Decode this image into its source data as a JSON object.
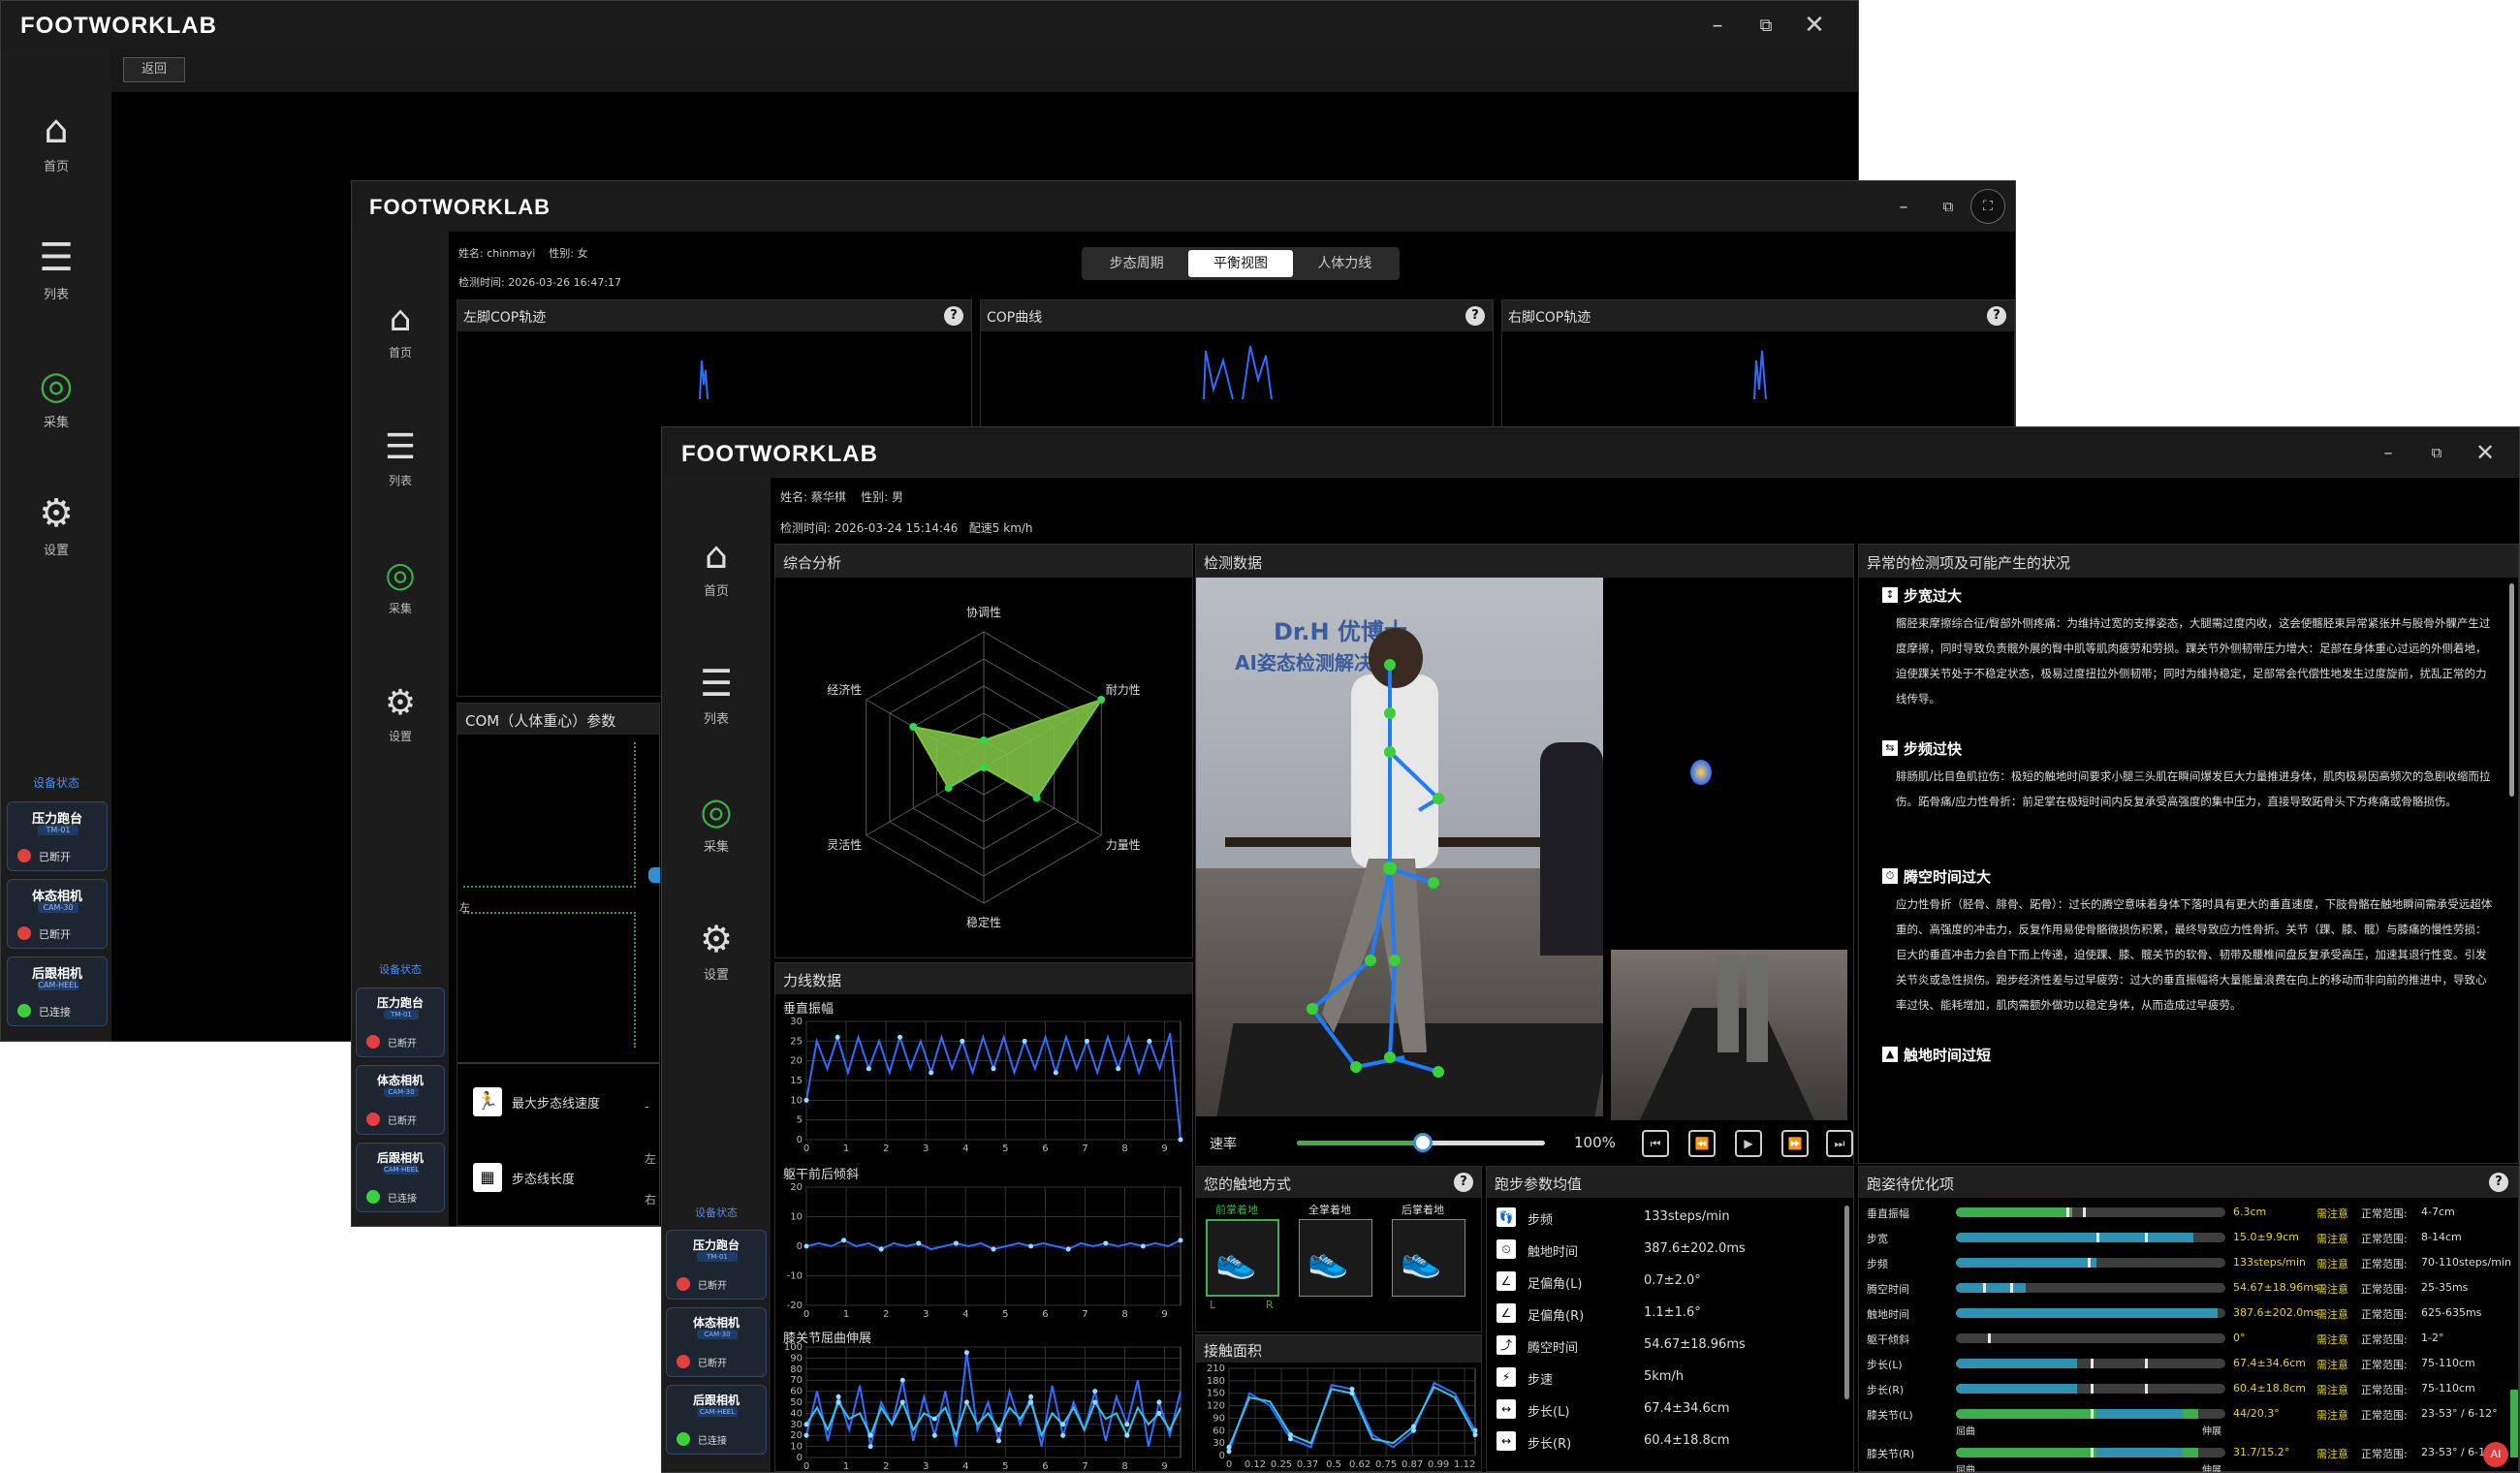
{
  "brand": "FOOTWORKLAB",
  "win1": {
    "back_label": "返回",
    "nav": [
      "首页",
      "列表",
      "采集",
      "设置"
    ],
    "device_header": "设备状态",
    "devices": [
      {
        "name": "压力跑台",
        "code": "TM-01",
        "status": "已断开",
        "state": "red"
      },
      {
        "name": "体态相机",
        "code": "CAM-30",
        "status": "已断开",
        "state": "red"
      },
      {
        "name": "后跟相机",
        "code": "CAM-HEEL",
        "status": "已连接",
        "state": "green"
      }
    ]
  },
  "win2": {
    "name_label": "姓名:",
    "name": "chinmayi",
    "gender_label": "性别:",
    "gender": "女",
    "time_label": "检测时间:",
    "time": "2026-03-26 16:47:17",
    "tabs": [
      "步态周期",
      "平衡视图",
      "人体力线"
    ],
    "active_tab": 1,
    "panels": [
      "左脚COP轨迹",
      "COP曲线",
      "右脚COP轨迹"
    ],
    "com_title": "COM（人体重心）参数",
    "com_left_label": "左",
    "params": [
      "最大步态线速度",
      "步态线长度"
    ],
    "param_side": [
      "左",
      "右"
    ],
    "param_dash": "-",
    "nav": [
      "首页",
      "列表",
      "采集",
      "设置"
    ],
    "device_header": "设备状态",
    "devices": [
      {
        "name": "压力跑台",
        "code": "TM-01",
        "status": "已断开",
        "state": "red"
      },
      {
        "name": "体态相机",
        "code": "CAM-30",
        "status": "已断开",
        "state": "red"
      },
      {
        "name": "后跟相机",
        "code": "CAM-HEEL",
        "status": "已连接",
        "state": "green"
      }
    ]
  },
  "win3": {
    "name_label": "姓名:",
    "name": "蔡华棋",
    "gender_label": "性别:",
    "gender": "男",
    "time_label": "检测时间:",
    "time": "2026-03-24 15:14:46",
    "speed_label": "配速",
    "speed": "5 km/h",
    "nav": [
      "首页",
      "列表",
      "采集",
      "设置"
    ],
    "device_header": "设备状态",
    "devices": [
      {
        "name": "压力跑台",
        "code": "TM-01",
        "status": "已断开",
        "state": "red"
      },
      {
        "name": "体态相机",
        "code": "CAM-30",
        "status": "已断开",
        "state": "red"
      },
      {
        "name": "后跟相机",
        "code": "CAM-HEEL",
        "status": "已连接",
        "state": "green"
      }
    ],
    "overall_title": "综合分析",
    "radar_axes": [
      "协调性",
      "耐力性",
      "力量性",
      "稳定性",
      "灵活性",
      "经济性"
    ],
    "force_title": "力线数据",
    "vert_osc_title": "垂直振幅",
    "trunk_title": "躯干前后倾斜",
    "knee_title": "膝关节屈曲伸展",
    "detect_title": "检测数据",
    "wall_text": [
      "Dr.H 优博士",
      "AI姿态检测解决方案"
    ],
    "speed_rate_label": "速率",
    "playback": "100%",
    "strike_title": "您的触地方式",
    "strike_types": [
      "前掌着地",
      "全掌着地",
      "后掌着地"
    ],
    "strike_lr": [
      "L",
      "R"
    ],
    "contact_title": "接触面积",
    "params_title": "跑步参数均值",
    "params": [
      {
        "label": "步频",
        "value": "133steps/min"
      },
      {
        "label": "触地时间",
        "value": "387.6±202.0ms"
      },
      {
        "label": "足偏角(L)",
        "value": "0.7±2.0°"
      },
      {
        "label": "足偏角(R)",
        "value": "1.1±1.6°"
      },
      {
        "label": "腾空时间",
        "value": "54.67±18.96ms"
      },
      {
        "label": "步速",
        "value": "5km/h"
      },
      {
        "label": "步长(L)",
        "value": "67.4±34.6cm"
      },
      {
        "label": "步长(R)",
        "value": "60.4±18.8cm"
      }
    ],
    "abnormal_title": "异常的检测项及可能产生的状况",
    "abnormal": [
      {
        "icon": "↕",
        "title": "步宽过大",
        "text": "髂胫束摩擦综合征/臀部外侧疼痛：为维持过宽的支撑姿态，大腿需过度内收，这会使髂胫束异常紧张并与股骨外髁产生过度摩擦，同时导致负责髋外展的臀中肌等肌肉疲劳和劳损。踝关节外侧韧带压力增大：足部在身体重心过远的外侧着地，迫使踝关节处于不稳定状态，极易过度扭拉外侧韧带；同时为维持稳定，足部常会代偿性地发生过度旋前，扰乱正常的力线传导。"
      },
      {
        "icon": "⇆",
        "title": "步频过快",
        "text": "腓肠肌/比目鱼肌拉伤：极短的触地时间要求小腿三头肌在瞬间爆发巨大力量推进身体，肌肉极易因高频次的急剧收缩而拉伤。跖骨痛/应力性骨折：前足掌在极短时间内反复承受高强度的集中压力，直接导致跖骨头下方疼痛或骨骼损伤。"
      },
      {
        "icon": "⏱",
        "title": "腾空时间过大",
        "text": "应力性骨折（胫骨、腓骨、跖骨）：过长的腾空意味着身体下落时具有更大的垂直速度，下肢骨骼在触地瞬间需承受远超体重的、高强度的冲击力，反复作用易使骨骼微损伤积累，最终导致应力性骨折。关节（踝、膝、髋）与膝痛的慢性劳损：巨大的垂直冲击力会自下而上传递，迫使踝、膝、髋关节的软骨、韧带及腰椎间盘反复承受高压，加速其退行性变。引发关节炎或急性损伤。跑步经济性差与过早疲劳：过大的垂直振幅将大量能量浪费在向上的移动而非向前的推进中，导致心率过快、能耗增加，肌肉需额外做功以稳定身体，从而造成过早疲劳。"
      },
      {
        "icon": "▲",
        "title": "触地时间过短",
        "text": ""
      }
    ],
    "opt_title": "跑姿待优化项",
    "opt_items": [
      {
        "label": "垂直振幅",
        "value": "6.3cm",
        "flag": "需注意",
        "range_label": "正常范围:",
        "range": "4-7cm",
        "fill": 0.43,
        "color": "#3daf4a",
        "ticks": [
          0.41,
          0.47
        ]
      },
      {
        "label": "步宽",
        "value": "15.0±9.9cm",
        "flag": "需注意",
        "range_label": "正常范围:",
        "range": "8-14cm",
        "fill": 0.88,
        "color": "#2e93b3",
        "ticks": [
          0.52,
          0.7
        ]
      },
      {
        "label": "步频",
        "value": "133steps/min",
        "flag": "需注意",
        "range_label": "正常范围:",
        "range": "70-110steps/min",
        "fill": 0.52,
        "color": "#2e93b3",
        "ticks": [
          0.49
        ]
      },
      {
        "label": "腾空时间",
        "value": "54.67±18.96ms",
        "flag": "需注意",
        "range_label": "正常范围:",
        "range": "25-35ms",
        "fill": 0.26,
        "color": "#2e93b3",
        "ticks": [
          0.1,
          0.2
        ]
      },
      {
        "label": "触地时间",
        "value": "387.6±202.0ms",
        "flag": "需注意",
        "range_label": "正常范围:",
        "range": "625-635ms",
        "fill": 0.97,
        "color": "#2e93b3",
        "ticks": []
      },
      {
        "label": "躯干倾斜",
        "value": "0°",
        "flag": "需注意",
        "range_label": "正常范围:",
        "range": "1-2°",
        "fill": 0.0,
        "color": "#2e93b3",
        "ticks": [
          0.12
        ]
      },
      {
        "label": "步长(L)",
        "value": "67.4±34.6cm",
        "flag": "需注意",
        "range_label": "正常范围:",
        "range": "75-110cm",
        "fill": 0.45,
        "color": "#2e93b3",
        "ticks": [
          0.5,
          0.7
        ]
      },
      {
        "label": "步长(R)",
        "value": "60.4±18.8cm",
        "flag": "需注意",
        "range_label": "正常范围:",
        "range": "75-110cm",
        "fill": 0.45,
        "color": "#2e93b3",
        "ticks": [
          0.5,
          0.7
        ]
      },
      {
        "label": "膝关节(L)",
        "value": "44/20.3°",
        "flag": "需注意",
        "range_label": "正常范围:",
        "range": "23-53° / 6-12°",
        "fill": 0.9,
        "color": "#3daf4a",
        "ticks": [
          0.5
        ],
        "sub": [
          "屈曲",
          "伸展"
        ]
      },
      {
        "label": "膝关节(R)",
        "value": "31.7/15.2°",
        "flag": "需注意",
        "range_label": "正常范围:",
        "range": "23-53° / 6-12°",
        "fill": 0.9,
        "color": "#3daf4a",
        "ticks": [
          0.5
        ],
        "sub": [
          "屈曲",
          "伸展"
        ]
      }
    ]
  },
  "chart_data": [
    {
      "type": "radar",
      "title": "综合分析",
      "axes": [
        "协调性",
        "耐力性",
        "力量性",
        "稳定性",
        "灵活性",
        "经济性"
      ],
      "values": [
        0.2,
        1.0,
        0.45,
        0.0,
        0.3,
        0.6
      ],
      "color": "#7ec242"
    },
    {
      "type": "line",
      "title": "垂直振幅",
      "x_ticks": [
        "0",
        "1",
        "2",
        "3",
        "4",
        "5",
        "6",
        "7",
        "8",
        "9"
      ],
      "y_ticks": [
        "0",
        "5",
        "10",
        "15",
        "20",
        "25",
        "30"
      ],
      "ylim": [
        0,
        30
      ],
      "series": [
        {
          "values": [
            10,
            25,
            18,
            26,
            17,
            26,
            18,
            25,
            17,
            26,
            18,
            25,
            17,
            26,
            18,
            25,
            17,
            26,
            18,
            26,
            17,
            25,
            18,
            26,
            17,
            26,
            18,
            25,
            17,
            26,
            18,
            26,
            17,
            25,
            18,
            27,
            0
          ]
        }
      ]
    },
    {
      "type": "line",
      "title": "躯干前后倾斜",
      "x_ticks": [
        "0",
        "1",
        "2",
        "3",
        "4",
        "5",
        "6",
        "7",
        "8",
        "9"
      ],
      "y_ticks": [
        "-20",
        "-10",
        "0",
        "10",
        "20"
      ],
      "ylim": [
        -20,
        20
      ],
      "series": [
        {
          "values": [
            0,
            1,
            0,
            2,
            0,
            1,
            -1,
            1,
            0,
            1,
            -1,
            0,
            1,
            0,
            1,
            -1,
            0,
            1,
            0,
            1,
            0,
            -1,
            1,
            0,
            1,
            0,
            1,
            0,
            1,
            0,
            2
          ]
        }
      ]
    },
    {
      "type": "line",
      "title": "膝关节屈曲伸展",
      "x_ticks": [
        "0",
        "1",
        "2",
        "3",
        "4",
        "5",
        "6",
        "7",
        "8",
        "9"
      ],
      "y_ticks": [
        "0",
        "10",
        "20",
        "30",
        "40",
        "50",
        "60",
        "70",
        "80",
        "90",
        "100"
      ],
      "ylim": [
        0,
        100
      ],
      "series": [
        {
          "values": [
            20,
            60,
            15,
            55,
            25,
            65,
            10,
            50,
            30,
            70,
            15,
            55,
            20,
            60,
            10,
            95,
            25,
            50,
            15,
            60,
            30,
            55,
            10,
            65,
            20,
            50,
            25,
            60,
            15,
            55,
            30,
            70,
            10,
            50,
            20,
            60
          ]
        },
        {
          "values": [
            30,
            45,
            25,
            50,
            35,
            40,
            20,
            45,
            30,
            50,
            25,
            40,
            35,
            45,
            20,
            50,
            30,
            40,
            25,
            45,
            35,
            50,
            20,
            40,
            30,
            45,
            25,
            50,
            35,
            40,
            20,
            45,
            30,
            40,
            25,
            45
          ]
        }
      ]
    },
    {
      "type": "line",
      "title": "接触面积",
      "x_ticks": [
        "0",
        "0.12",
        "0.25",
        "0.37",
        "0.5",
        "0.62",
        "0.75",
        "0.87",
        "0.99",
        "1.12"
      ],
      "y_ticks": [
        "0",
        "30",
        "60",
        "90",
        "120",
        "150",
        "180",
        "210"
      ],
      "ylim": [
        0,
        210
      ],
      "series": [
        {
          "values": [
            10,
            150,
            120,
            40,
            20,
            170,
            160,
            50,
            20,
            60,
            175,
            150,
            60
          ]
        },
        {
          "values": [
            20,
            140,
            130,
            50,
            30,
            160,
            150,
            40,
            30,
            70,
            165,
            140,
            50
          ]
        }
      ]
    }
  ]
}
